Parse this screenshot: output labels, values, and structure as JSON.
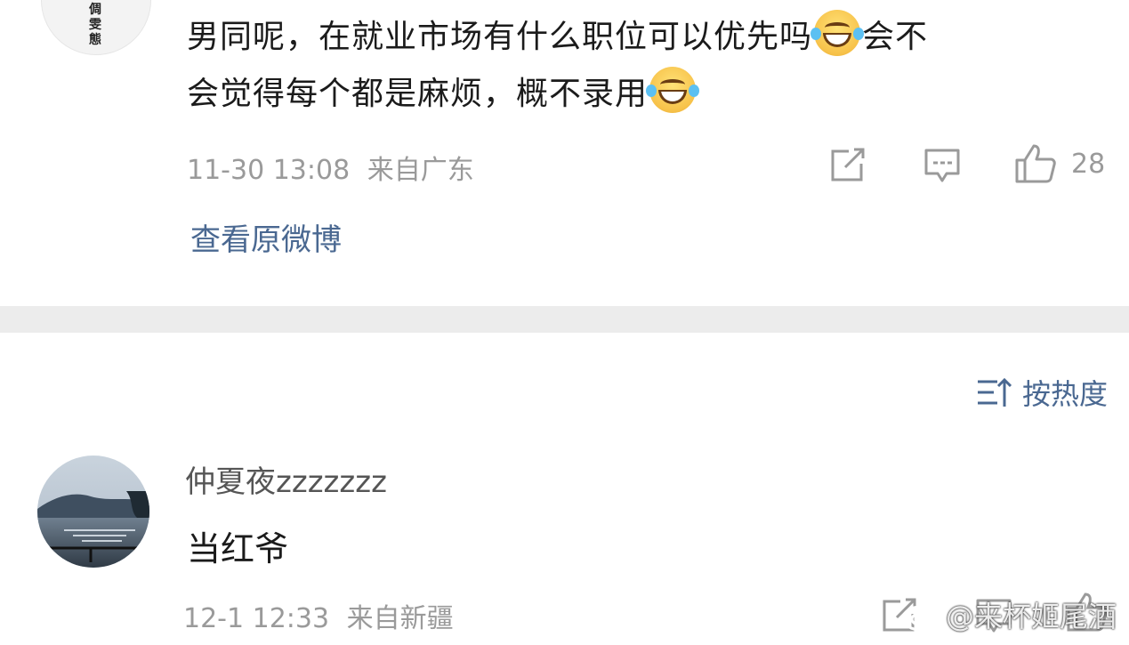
{
  "comment1": {
    "avatar_text": "倜\n雯\n態",
    "text_line1_a": "男同呢，在就业市场有什么职位可以优先吗",
    "text_line1_b": "会不",
    "text_line2": "会觉得每个都是麻烦，概不录用",
    "time": "11-30 13:08",
    "location": "来自广东",
    "like_count": "28",
    "view_original": "查看原微博"
  },
  "sort": {
    "label": "按热度"
  },
  "comment2": {
    "username": "仲夏夜zzzzzzz",
    "text": "当红爷",
    "time": "12-1 12:33",
    "location": "来自新疆"
  },
  "watermark": {
    "text": "@来杯姬尾酒"
  },
  "colors": {
    "link": "#4a6891",
    "meta": "#9a9a9a",
    "divider": "#ececec"
  },
  "icons": [
    "share-icon",
    "comment-icon",
    "like-icon",
    "sort-icon",
    "laughing-tears-emoji"
  ]
}
